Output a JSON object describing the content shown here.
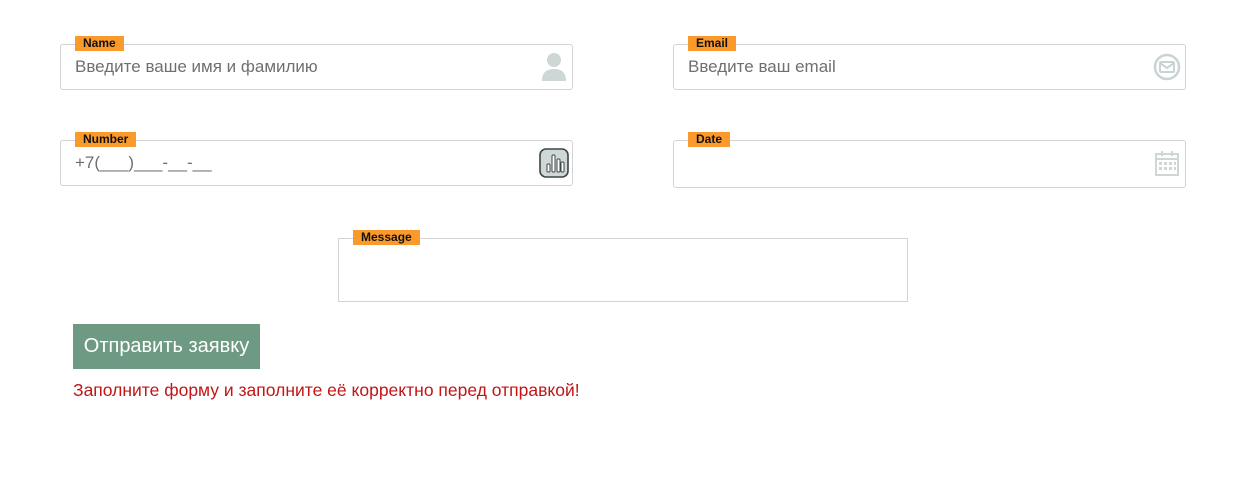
{
  "form": {
    "name": {
      "label": "Name",
      "placeholder": "Введите ваше имя и фамилию",
      "value": "",
      "icon": "user-icon"
    },
    "email": {
      "label": "Email",
      "placeholder": "Введите ваш email",
      "value": "",
      "icon": "envelope-icon"
    },
    "number": {
      "label": "Number",
      "placeholder": "+7(___)___-__-__",
      "value": "",
      "icon": "phone-keypad-icon"
    },
    "date": {
      "label": "Date",
      "placeholder": "",
      "value": "",
      "icon": "calendar-icon"
    },
    "message": {
      "label": "Message",
      "placeholder": "",
      "value": ""
    },
    "submit_label": "Отправить заявку",
    "error_text": "Заполните форму и заполните её корректно перед отправкой!"
  },
  "colors": {
    "label_bg": "#fb9a2c",
    "button_bg": "#6e9a83",
    "error": "#c01616",
    "border": "#d3d3d3"
  }
}
